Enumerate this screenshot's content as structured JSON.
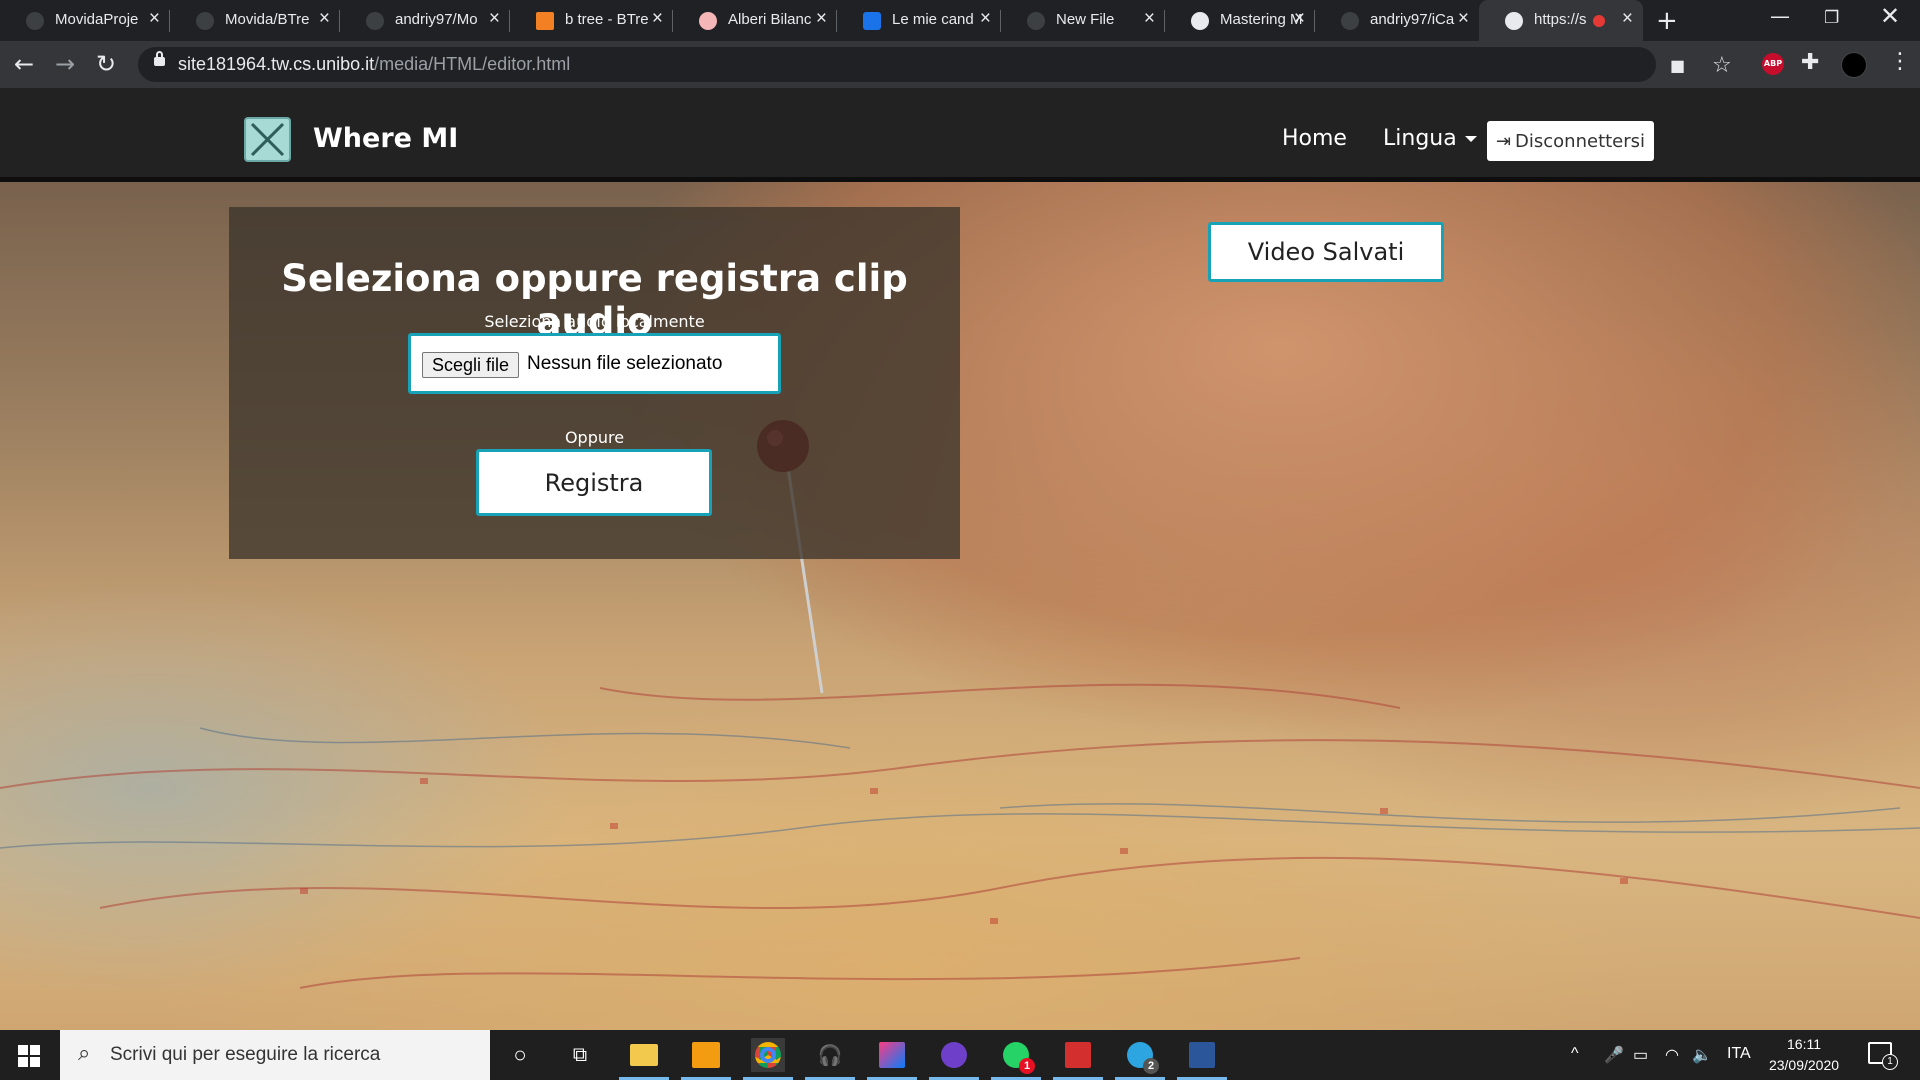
{
  "browser": {
    "tabs": [
      {
        "title": "MovidaProje",
        "active": false
      },
      {
        "title": "Movida/BTre",
        "active": false
      },
      {
        "title": "andriy97/Mo",
        "active": false
      },
      {
        "title": "b tree - BTre",
        "active": false
      },
      {
        "title": "Alberi Bilanc",
        "active": false
      },
      {
        "title": "Le mie cand",
        "active": false
      },
      {
        "title": "New File",
        "active": false
      },
      {
        "title": "Mastering M",
        "active": false
      },
      {
        "title": "andriy97/iCa",
        "active": false
      },
      {
        "title": "https://s",
        "active": true
      }
    ],
    "url_host": "site181964.tw.cs.unibo.it",
    "url_path": "/media/HTML/editor.html",
    "icons": {
      "back": "back-arrow-icon",
      "forward": "forward-arrow-icon",
      "reload": "reload-icon",
      "camera": "camera-icon",
      "star": "bookmark-star-icon",
      "extensions": "puzzle-icon",
      "menu": "kebab-menu-icon"
    },
    "abp_label": "ABP"
  },
  "page": {
    "brand": "Where MI",
    "nav": {
      "home": "Home",
      "language": "Lingua",
      "logout": "Disconnettersi"
    },
    "panel": {
      "title": "Seleziona oppure registra clip audio",
      "local_label": "Seleziona audio localmente",
      "file_button": "Scegli file",
      "file_status": "Nessun file selezionato",
      "or_label": "Oppure",
      "record_button": "Registra"
    },
    "saved_videos_button": "Video Salvati"
  },
  "taskbar": {
    "search_placeholder": "Scrivi qui per eseguire la ricerca",
    "keyboard_lang": "ITA",
    "time": "16:11",
    "date": "23/09/2020",
    "notification_count": "1",
    "telegram_badge": "2",
    "whatsapp_badge": "1"
  },
  "colors": {
    "accent": "#17a2b8",
    "navbar": "#222222",
    "chrome_bg": "#202124"
  }
}
